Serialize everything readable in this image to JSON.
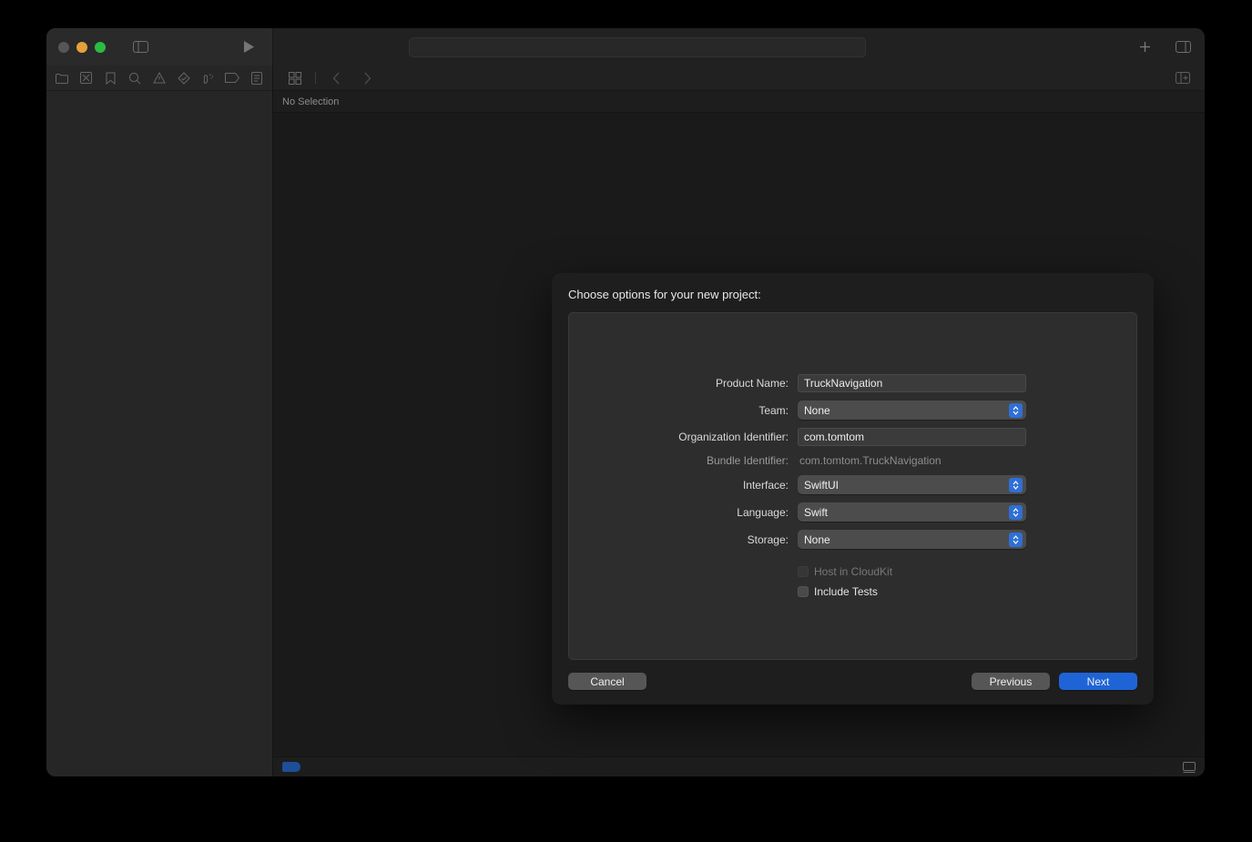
{
  "window": {
    "traffic_lights": [
      "close",
      "minimize",
      "maximize"
    ],
    "titlebar": {
      "sidebar_toggle_icon": "sidebar-toggle-icon",
      "run_icon": "run-play-icon",
      "add_icon": "plus-icon",
      "inspector_toggle_icon": "inspector-toggle-icon",
      "activity_view_text": ""
    },
    "navigator": {
      "tabs": [
        {
          "name": "project-navigator",
          "icon": "folder-icon"
        },
        {
          "name": "source-control-navigator",
          "icon": "source-control-icon"
        },
        {
          "name": "bookmark-navigator",
          "icon": "bookmark-icon"
        },
        {
          "name": "find-navigator",
          "icon": "search-icon"
        },
        {
          "name": "issue-navigator",
          "icon": "warning-triangle-icon"
        },
        {
          "name": "test-navigator",
          "icon": "diamond-icon"
        },
        {
          "name": "debug-navigator",
          "icon": "debug-spray-icon"
        },
        {
          "name": "breakpoint-navigator",
          "icon": "breakpoint-tag-icon"
        },
        {
          "name": "report-navigator",
          "icon": "report-list-icon"
        }
      ],
      "content": ""
    },
    "editor": {
      "toolbar": {
        "grid_icon": "grid-layout-icon",
        "back_icon": "chevron-left-icon",
        "forward_icon": "chevron-right-icon",
        "add_editor_icon": "add-editor-icon"
      },
      "jumpbar_text": "No Selection",
      "status_bar": {
        "filter_tag": "blue-tag-indicator",
        "device_icon": "device-icon"
      }
    }
  },
  "dialog": {
    "title": "Choose options for your new project:",
    "fields": [
      {
        "label": "Product Name:",
        "type": "textfield",
        "value": "TruckNavigation",
        "name": "product-name"
      },
      {
        "label": "Team:",
        "type": "popup",
        "value": "None",
        "name": "team"
      },
      {
        "label": "Organization Identifier:",
        "type": "textfield",
        "value": "com.tomtom",
        "name": "organization-identifier"
      },
      {
        "label": "Bundle Identifier:",
        "type": "static",
        "value": "com.tomtom.TruckNavigation",
        "name": "bundle-identifier"
      },
      {
        "label": "Interface:",
        "type": "popup",
        "value": "SwiftUI",
        "name": "interface"
      },
      {
        "label": "Language:",
        "type": "popup",
        "value": "Swift",
        "name": "language"
      },
      {
        "label": "Storage:",
        "type": "popup",
        "value": "None",
        "name": "storage"
      }
    ],
    "checkboxes": [
      {
        "label": "Host in CloudKit",
        "checked": false,
        "disabled": true,
        "name": "host-in-cloudkit"
      },
      {
        "label": "Include Tests",
        "checked": false,
        "disabled": false,
        "name": "include-tests"
      }
    ],
    "buttons": {
      "cancel": "Cancel",
      "previous": "Previous",
      "next": "Next"
    }
  },
  "colors": {
    "accent_blue": "#1f64d6",
    "popup_arrow_blue": "#2f6fd6",
    "window_bg": "#1f1f1f",
    "dialog_bg": "#1e1e1e",
    "panel_bg": "#2d2d2d",
    "editor_bg": "#1a1a1a",
    "tag_blue": "#1c4f96",
    "minimize_yellow": "#e5a13a",
    "maximize_green": "#2cbb43"
  }
}
